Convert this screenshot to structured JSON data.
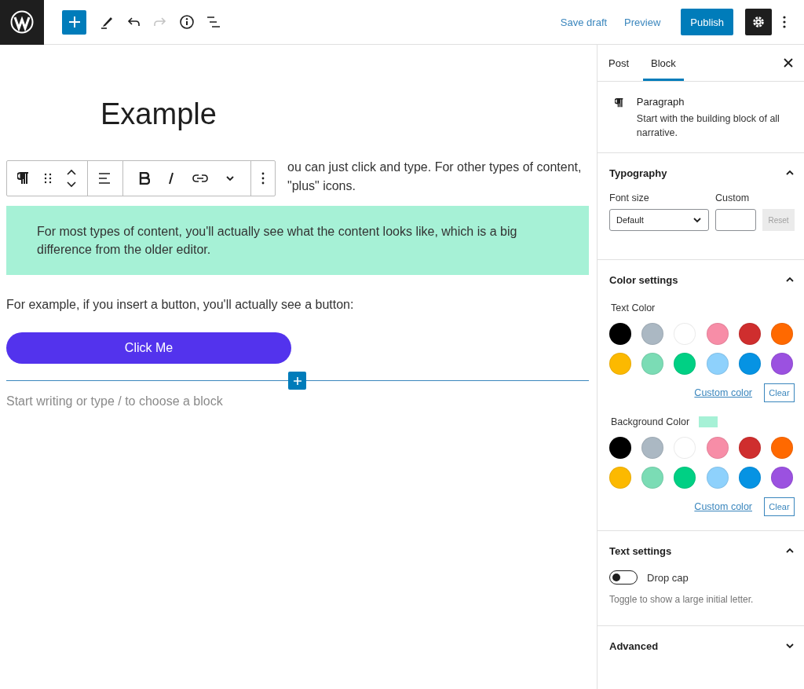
{
  "topbar": {
    "save_draft": "Save draft",
    "preview": "Preview",
    "publish": "Publish",
    "redo_disabled": true,
    "settings_on": true
  },
  "editor": {
    "title": "Example",
    "paragraph_lines": [
      "ou can just click and type. For other types of content,",
      "\"plus\" icons."
    ],
    "highlight": {
      "text": "For most types of content, you'll actually see what the content looks like, which is a big difference from the older editor.",
      "color": "#a6f1d6"
    },
    "paragraph_2": "For example, if you insert a button, you'll actually see a button:",
    "button": {
      "label": "Click Me",
      "color": "#5333ed"
    },
    "placeholder": "Start writing or type / to choose a block"
  },
  "sidebar": {
    "tabs": [
      {
        "label": "Post",
        "selected": false
      },
      {
        "label": "Block",
        "selected": true
      }
    ],
    "block_card": {
      "name": "Paragraph",
      "description": "Start with the building block of all narrative."
    },
    "typography": {
      "title": "Typography",
      "expanded": true,
      "font_size_label": "Font size",
      "font_size_value": "Default",
      "custom_label": "Custom",
      "reset": "Reset"
    },
    "color_settings": {
      "title": "Color settings",
      "expanded": true,
      "text_color": {
        "label": "Text Color",
        "custom_color": "Custom color",
        "clear": "Clear",
        "swatches": [
          {
            "color": "#000000"
          },
          {
            "color": "#abb8c3"
          },
          {
            "color": "#ffffff"
          },
          {
            "color": "#f78da7"
          },
          {
            "color": "#cf2e2e"
          },
          {
            "color": "#ff6900"
          },
          {
            "color": "#fcb900"
          },
          {
            "color": "#7bdcb5"
          },
          {
            "color": "#00d084"
          },
          {
            "color": "#8ed1fc"
          },
          {
            "color": "#0693e3"
          },
          {
            "color": "#9b51e0"
          }
        ]
      },
      "background_color": {
        "label": "Background Color",
        "custom_color": "Custom color",
        "clear": "Clear",
        "swatches": [
          {
            "color": "#000000"
          },
          {
            "color": "#abb8c3"
          },
          {
            "color": "#ffffff"
          },
          {
            "color": "#f78da7"
          },
          {
            "color": "#cf2e2e"
          },
          {
            "color": "#ff6900"
          },
          {
            "color": "#fcb900"
          },
          {
            "color": "#7bdcb5"
          },
          {
            "color": "#00d084"
          },
          {
            "color": "#8ed1fc"
          },
          {
            "color": "#0693e3"
          },
          {
            "color": "#9b51e0"
          }
        ]
      }
    },
    "text_settings": {
      "title": "Text settings",
      "expanded": true,
      "drop_cap": {
        "label": "Drop cap",
        "on": false
      },
      "help": "Toggle to show a large initial letter."
    },
    "advanced": {
      "title": "Advanced",
      "expanded": false
    }
  }
}
